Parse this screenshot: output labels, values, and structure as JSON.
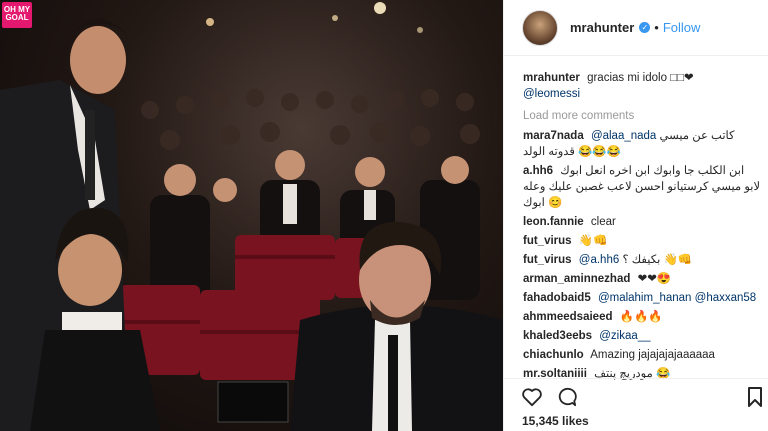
{
  "watermark": "OH MY GOAL",
  "header": {
    "username": "mrahunter",
    "verified_glyph": "✓",
    "separator": "•",
    "follow_label": "Follow"
  },
  "caption": {
    "user": "mrahunter",
    "text": "gracias mi idolo □□❤",
    "mention": "@leomessi"
  },
  "load_more": "Load more comments",
  "comments": [
    {
      "user": "mara7nada",
      "mention": "@alaa_nada",
      "text": "كاتب عن ميسي قدوته الولد 😂😂😂"
    },
    {
      "user": "a.hh6",
      "mention": "",
      "text": "ابن الكلب جا وابوك ابن اخره انعل ابوك لابو ميسي كرستيانو احسن لاعب غصبن عليك وعله ابوك 😊"
    },
    {
      "user": "leon.fannie",
      "mention": "",
      "text": "clear"
    },
    {
      "user": "fut_virus",
      "mention": "",
      "text": "👋👊"
    },
    {
      "user": "fut_virus",
      "mention": "@a.hh6",
      "text": "بكيفك ؟ 👋👊"
    },
    {
      "user": "arman_aminnezhad",
      "mention": "",
      "text": "❤❤😍"
    },
    {
      "user": "fahadobaid5",
      "mention": "@malahim_hanan",
      "text": "@haxxan58"
    },
    {
      "user": "ahmmeedsaieed",
      "mention": "",
      "text": "🔥🔥🔥"
    },
    {
      "user": "khaled3eebs",
      "mention": "@zikaa__",
      "text": ""
    },
    {
      "user": "chiachunlo",
      "mention": "",
      "text": "Amazing jajajajajaaaaaa"
    },
    {
      "user": "mr.soltaniiii",
      "mention": "",
      "text": "مودريچ پنتف 😂"
    }
  ],
  "likes": "15,345 likes",
  "colors": {
    "accent": "#3897f0",
    "mention": "#003569",
    "muted": "#999999",
    "watermark": "#e5186f"
  }
}
